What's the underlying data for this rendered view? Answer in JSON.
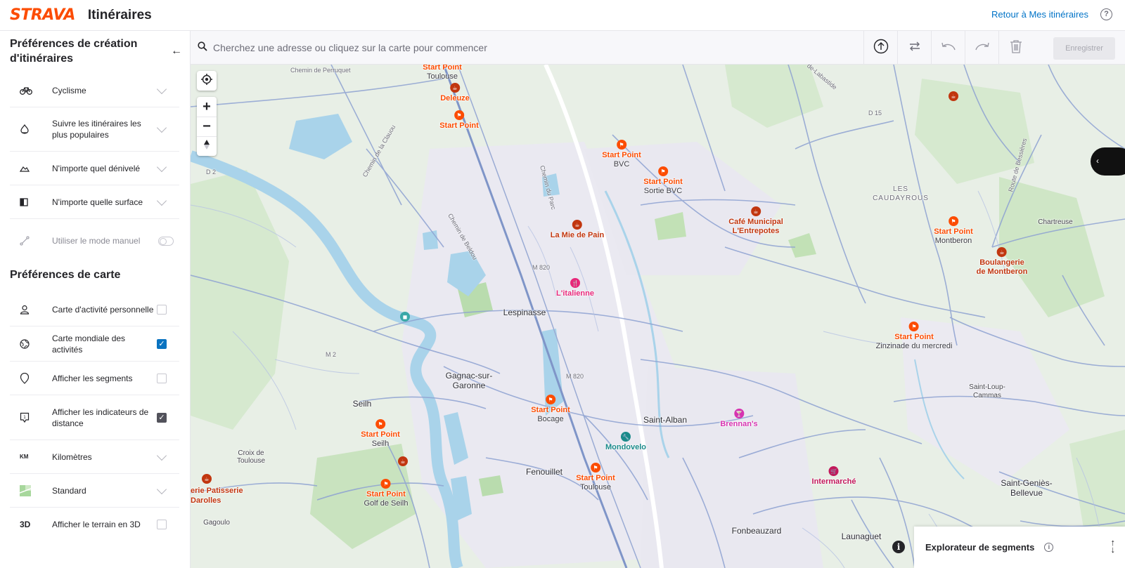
{
  "header": {
    "logo": "STRAVA",
    "title": "Itinéraires",
    "back_link": "Retour à Mes itinéraires",
    "help": "?"
  },
  "sidebar": {
    "route_prefs_title": "Préférences de création d'itinéraires",
    "route_prefs": [
      {
        "label": "Cyclisme",
        "icon": "bike-icon"
      },
      {
        "label": "Suivre les itinéraires les plus populaires",
        "icon": "heatmap-icon"
      },
      {
        "label": "N'importe quel dénivelé",
        "icon": "elevation-icon"
      },
      {
        "label": "N'importe quelle surface",
        "icon": "surface-icon"
      },
      {
        "label": "Utiliser le mode manuel",
        "icon": "manual-icon"
      }
    ],
    "map_prefs_title": "Préférences de carte",
    "map_prefs": [
      {
        "label": "Carte d'activité personnelle",
        "icon": "person-icon",
        "checked": false
      },
      {
        "label": "Carte mondiale des activités",
        "icon": "globe-icon",
        "checked": true
      },
      {
        "label": "Afficher les segments",
        "icon": "segment-icon",
        "checked": false
      },
      {
        "label": "Afficher les indicateurs de distance",
        "icon": "distance-marker-icon",
        "checked": true
      },
      {
        "label": "Kilomètres",
        "icon_text": "KM"
      },
      {
        "label": "Standard",
        "icon": "map-style-icon"
      },
      {
        "label": "Afficher le terrain en 3D",
        "icon_text": "3D",
        "checked": false
      }
    ]
  },
  "toolbar": {
    "search_placeholder": "Cherchez une adresse ou cliquez sur la carte pour commencer",
    "save_label": "Enregistrer"
  },
  "map": {
    "pois": [
      {
        "name": "Start Point",
        "sub": "Toulouse",
        "color": "#fc4c02"
      },
      {
        "name": "Deleuze",
        "sub": "",
        "color": "#fc4c02"
      },
      {
        "name": "Start Point",
        "sub": "",
        "color": "#fc4c02"
      },
      {
        "name": "Start Point",
        "sub": "BVC",
        "color": "#fc4c02"
      },
      {
        "name": "Start Point",
        "sub": "Sortie BVC",
        "color": "#fc4c02"
      },
      {
        "name": "Café Municipal",
        "sub": "L'Entrepotes",
        "color": "#c1360f"
      },
      {
        "name": "La Mie de Pain",
        "sub": "",
        "color": "#c1360f"
      },
      {
        "name": "L'italienne",
        "sub": "",
        "color": "#e8287a"
      },
      {
        "name": "Start Point",
        "sub": "Montberon",
        "color": "#fc4c02"
      },
      {
        "name": "Boulangerie",
        "sub": "de Montberon",
        "color": "#c1360f"
      },
      {
        "name": "Start Point",
        "sub": "Zinzinade du mercredi",
        "color": "#fc4c02"
      },
      {
        "name": "Start Point",
        "sub": "Bocage",
        "color": "#fc4c02"
      },
      {
        "name": "Start Point",
        "sub": "Seilh",
        "color": "#fc4c02"
      },
      {
        "name": "Mondovelo",
        "sub": "",
        "color": "#1a8a8a"
      },
      {
        "name": "Start Point",
        "sub": "Toulouse",
        "color": "#fc4c02"
      },
      {
        "name": "Brennan's",
        "sub": "",
        "color": "#d633b0"
      },
      {
        "name": "Intermarché",
        "sub": "",
        "color": "#c2185b"
      },
      {
        "name": "Start Point",
        "sub": "Golf de Seilh",
        "color": "#fc4c02"
      },
      {
        "name": "erie Patisserie",
        "sub": "",
        "color": "#c1360f"
      },
      {
        "name": "Darolles",
        "sub": "",
        "color": "#c1360f"
      }
    ],
    "places": [
      "Lespinasse",
      "Gagnac-sur-",
      "Garonne",
      "Seilh",
      "Saint-Alban",
      "Fenouillet",
      "Fonbeauzard",
      "Launaguet",
      "Saint-Loup-",
      "Cammas",
      "Saint-Geniès-",
      "Bellevue",
      "Croix de",
      "Toulouse",
      "Gagoulo",
      "Chartreuse",
      "LES",
      "CAUDAYROUS"
    ],
    "roads": [
      "Chemin de Perruquet",
      "Chemin de la Clauou",
      "Chemin du Parc",
      "Chemin de Beldou",
      "M 820",
      "M 820",
      "M 2",
      "D 2",
      "D 15",
      "Route de Bessières",
      "de-Labastide"
    ]
  },
  "segment_explorer": {
    "title": "Explorateur de segments"
  },
  "colors": {
    "brand": "#fc4c02",
    "link": "#0073c7",
    "checkbox": "#0a73c0"
  }
}
